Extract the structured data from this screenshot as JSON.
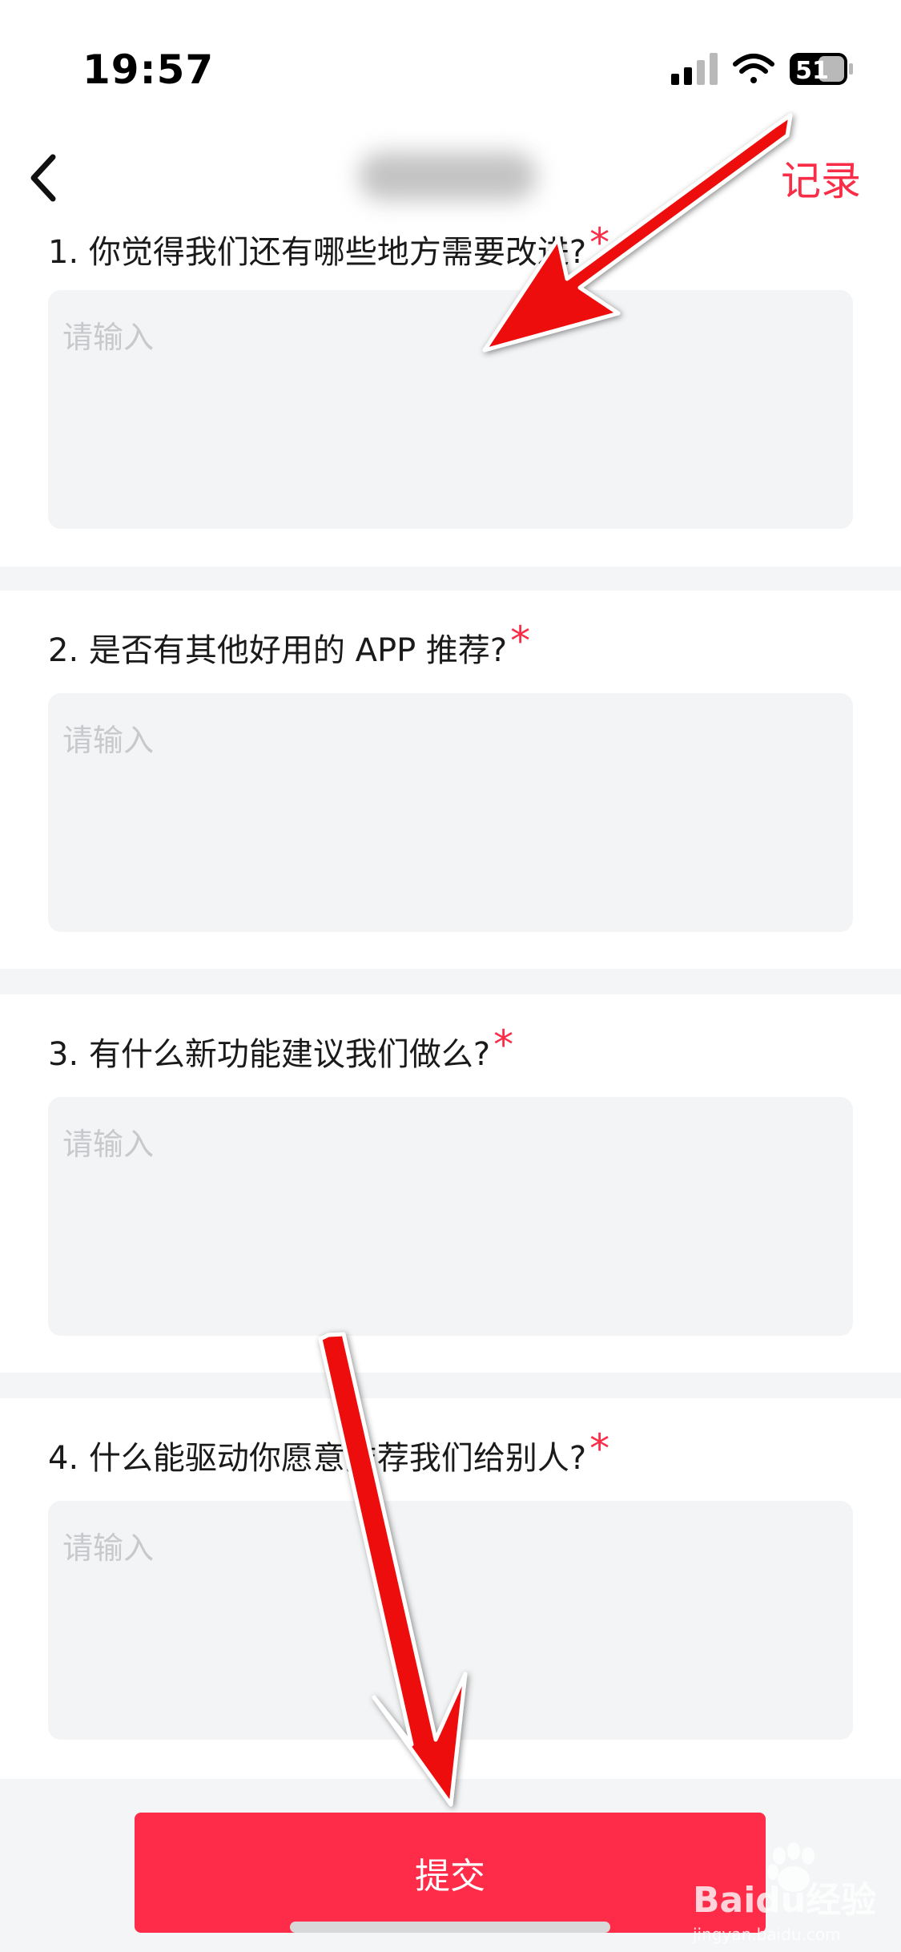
{
  "status_bar": {
    "time": "19:57",
    "battery": "51",
    "icons": [
      "signal-icon",
      "wifi-icon",
      "battery-icon"
    ]
  },
  "nav": {
    "back_icon": "chevron-left-icon",
    "record_label": "记录"
  },
  "questions": [
    {
      "label": "1. 你觉得我们还有哪些地方需要改进?",
      "required": "*",
      "placeholder": "请输入"
    },
    {
      "label": "2. 是否有其他好用的 APP 推荐?",
      "required": "*",
      "placeholder": "请输入"
    },
    {
      "label": "3. 有什么新功能建议我们做么?",
      "required": "*",
      "placeholder": "请输入"
    },
    {
      "label": "4. 什么能驱动你愿意推荐我们给别人?",
      "required": "*",
      "placeholder": "请输入"
    }
  ],
  "footer": {
    "submit_label": "提交"
  },
  "watermark": {
    "logo_text": "Baidu经验",
    "url_text": "jingyan.baidu.com"
  },
  "colors": {
    "accent": "#fa2d48",
    "submit_bg": "#fe2c49",
    "page_bg": "#f4f5f6",
    "input_bg": "#f3f4f5",
    "annotation_arrow": "#ee0a0a"
  }
}
